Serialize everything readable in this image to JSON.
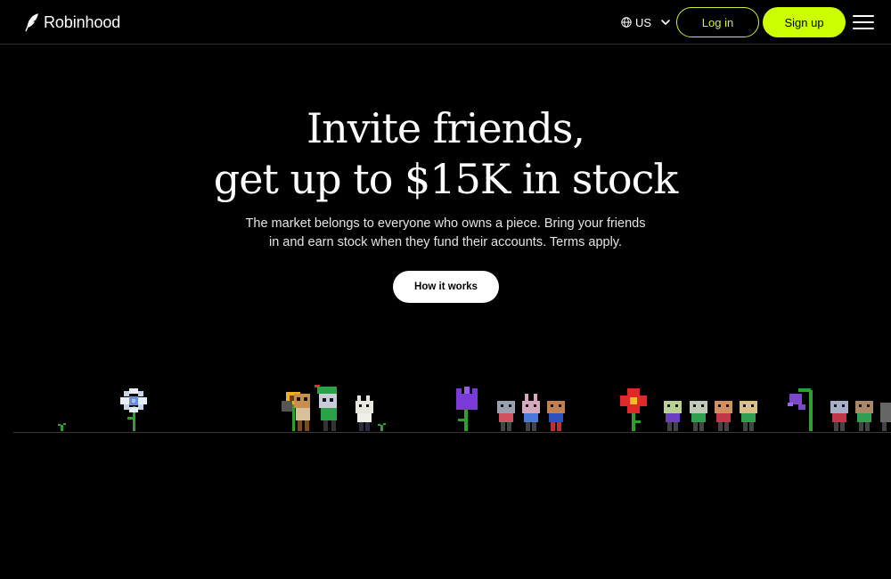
{
  "header": {
    "brand": "Robinhood",
    "brand_icon": "feather-logo-icon",
    "locale_label": "US",
    "login_label": "Log in",
    "signup_label": "Sign up",
    "accent_color": "#ccff00"
  },
  "hero": {
    "title_line1": "Invite friends,",
    "title_line2": "get up to $15K in stock",
    "subtitle_line1": "The market belongs to everyone who owns a piece. Bring your friends",
    "subtitle_line2": "in and earn stock when they fund their accounts. Terms apply.",
    "cta_label": "How it works"
  }
}
